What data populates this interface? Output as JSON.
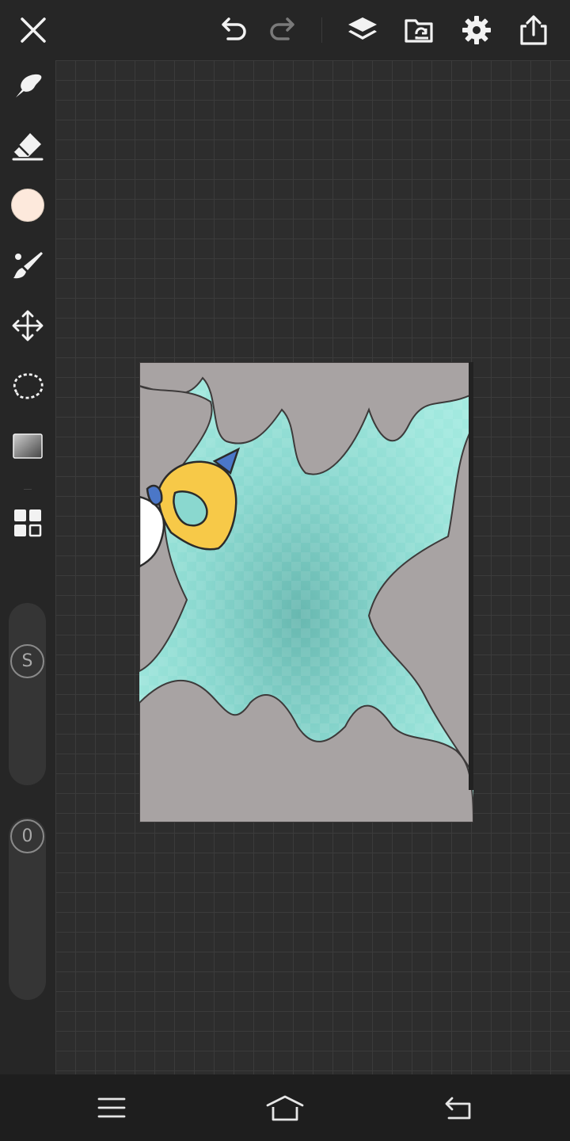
{
  "topbar": {
    "icons": [
      "close-icon",
      "undo-icon",
      "redo-icon",
      "layers-icon",
      "open-folder-icon",
      "settings-icon",
      "share-icon"
    ]
  },
  "sidebar": {
    "tools": [
      "brush-icon",
      "eraser-icon",
      "color-swatch",
      "brush-settings-icon",
      "move-icon",
      "lasso-icon",
      "gradient-icon",
      "materials-icon"
    ],
    "current_color": "#fde9dc",
    "size_slider": {
      "badge": "S"
    },
    "opacity_slider": {
      "badge": "0"
    }
  },
  "canvas": {
    "background_color": "#2d2d2d",
    "artwork_bg_color": "#8ad8cf"
  },
  "navbar": {
    "icons": [
      "menu-icon",
      "home-icon",
      "back-icon"
    ]
  },
  "colors": {
    "toolbar_bg": "#262626",
    "icon": "#f2f2f2",
    "icon_disabled": "#7a7a7a",
    "nav_bg": "#1e1e1e"
  }
}
